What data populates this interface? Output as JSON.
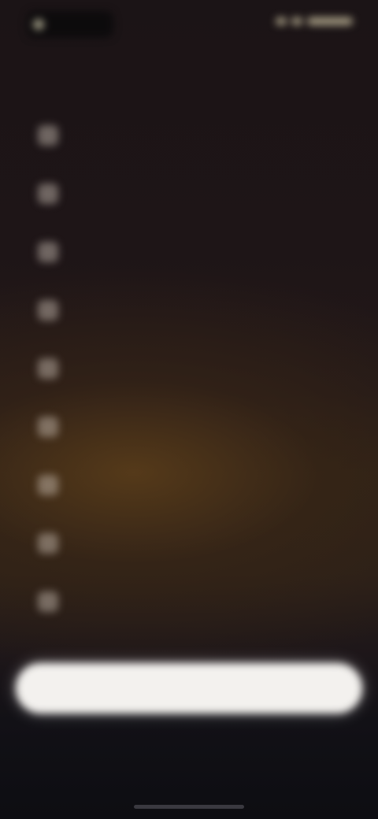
{
  "status_bar": {
    "time": "",
    "left_icon": "app-icon",
    "right_icons": [
      "signal-icon",
      "wifi-icon",
      "battery-icon"
    ]
  },
  "header": {
    "left_label": "",
    "right_label": ""
  },
  "menu": {
    "items": [
      {
        "label": "",
        "icon": "menu-item-icon"
      },
      {
        "label": "",
        "icon": "menu-item-icon"
      },
      {
        "label": "",
        "icon": "menu-item-icon"
      },
      {
        "label": "",
        "icon": "menu-item-icon"
      },
      {
        "label": "",
        "icon": "menu-item-icon"
      },
      {
        "label": "",
        "icon": "menu-item-icon"
      },
      {
        "label": "",
        "icon": "menu-item-icon"
      },
      {
        "label": "",
        "icon": "menu-item-icon"
      },
      {
        "label": "",
        "icon": "menu-item-icon"
      }
    ]
  },
  "bottom_button": {
    "label": ""
  },
  "footer": {
    "text": ""
  },
  "colors": {
    "background_top": "#1b1416",
    "background_glow": "#5c3e1a",
    "background_bottom": "#0d0d12",
    "button_bg": "#f3f1ee"
  }
}
